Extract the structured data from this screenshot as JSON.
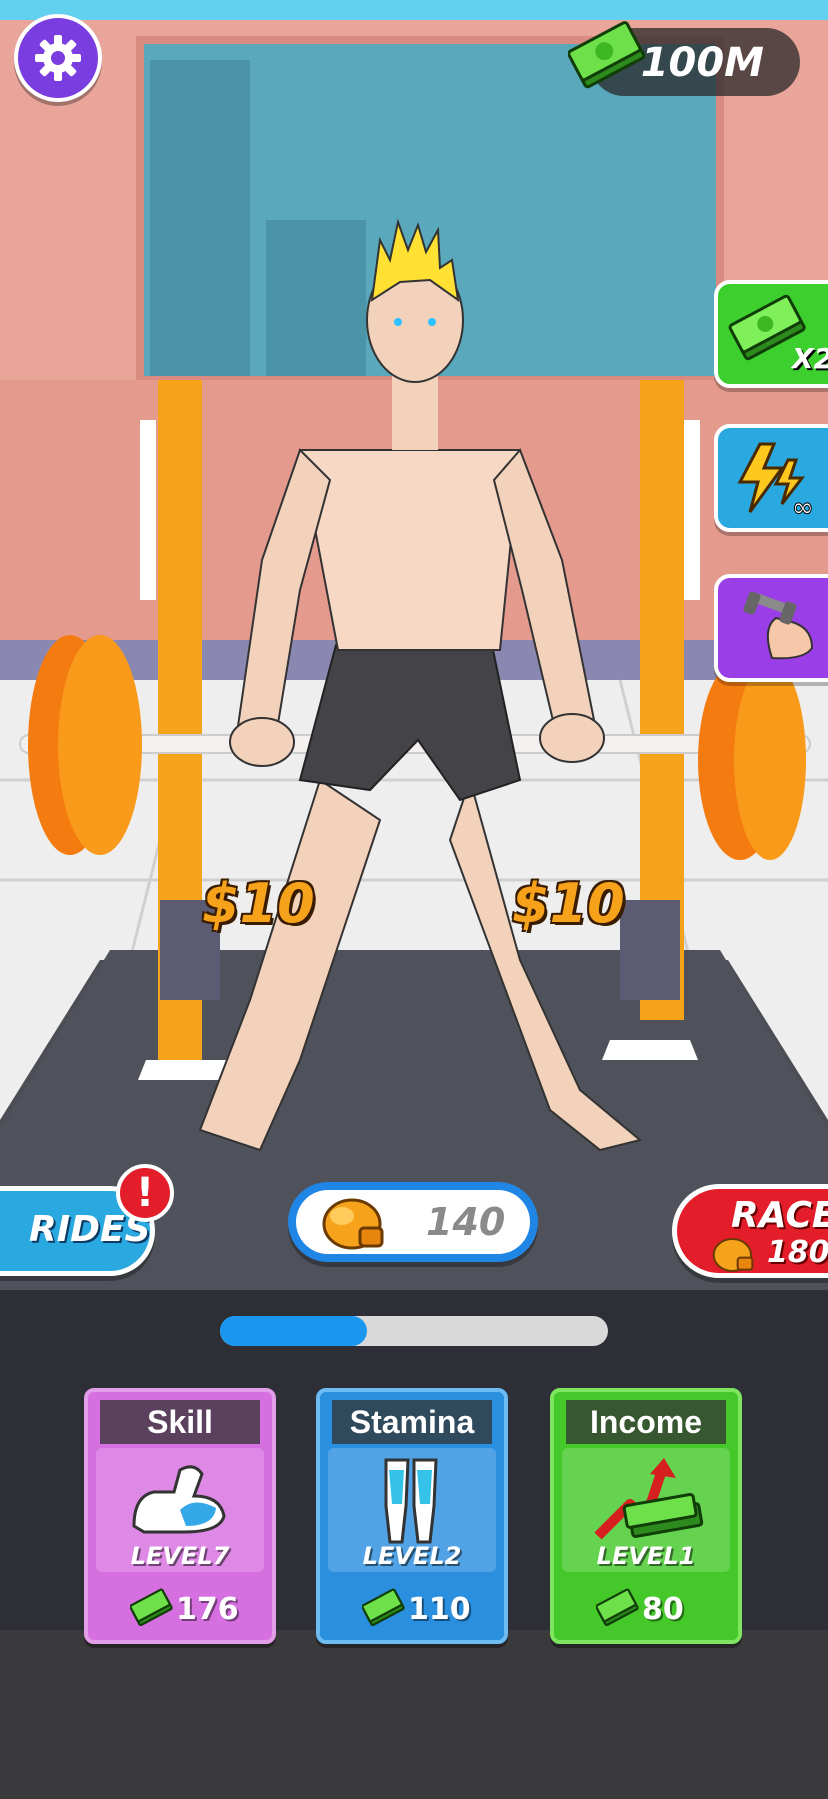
{
  "hud": {
    "settings_icon": "gear-icon",
    "money": "100M",
    "money_icon": "cash-stack-icon"
  },
  "boosters": {
    "income_multiplier_label": "X2",
    "income_multiplier_icon": "cash-stack-icon",
    "infinite_energy_icon": "lightning-infinity-icon",
    "auto_lift_icon": "dumbbell-arm-icon"
  },
  "scene": {
    "left_weight_price": "$10",
    "right_weight_price": "$10"
  },
  "rides": {
    "label": "RIDES",
    "alert": "!"
  },
  "strength": {
    "value": "140",
    "icon": "boxing-glove-icon"
  },
  "race": {
    "label": "RACE",
    "cost": "180",
    "icon": "boxing-glove-icon"
  },
  "progress": {
    "fraction": 0.38
  },
  "upgrades": [
    {
      "title": "Skill",
      "level": "LEVEL7",
      "cost": "176",
      "icon": "flexed-arm-icon",
      "color": "#d66fe0"
    },
    {
      "title": "Stamina",
      "level": "LEVEL2",
      "cost": "110",
      "icon": "legs-icon",
      "color": "#2b8fe0"
    },
    {
      "title": "Income",
      "level": "LEVEL1",
      "cost": "80",
      "icon": "cash-growth-icon",
      "color": "#44c82a"
    }
  ]
}
